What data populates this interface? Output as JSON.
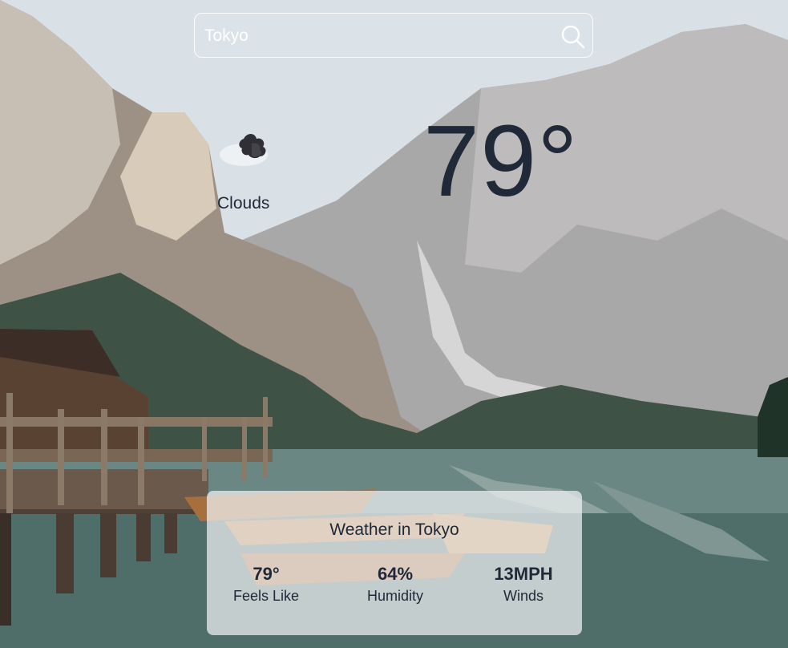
{
  "search": {
    "value": "Tokyo",
    "placeholder": ""
  },
  "icons": {
    "search": "search-icon",
    "weather": "clouds-icon"
  },
  "current": {
    "condition": "Clouds",
    "temperature": "79°"
  },
  "card": {
    "title": "Weather in Tokyo",
    "stats": [
      {
        "value": "79°",
        "label": "Feels Like"
      },
      {
        "value": "64%",
        "label": "Humidity"
      },
      {
        "value": "13MPH",
        "label": "Winds"
      }
    ]
  },
  "colors": {
    "text_dark": "#1f2937",
    "search_border": "#ffffff",
    "card_background": "#f0f2f4"
  }
}
